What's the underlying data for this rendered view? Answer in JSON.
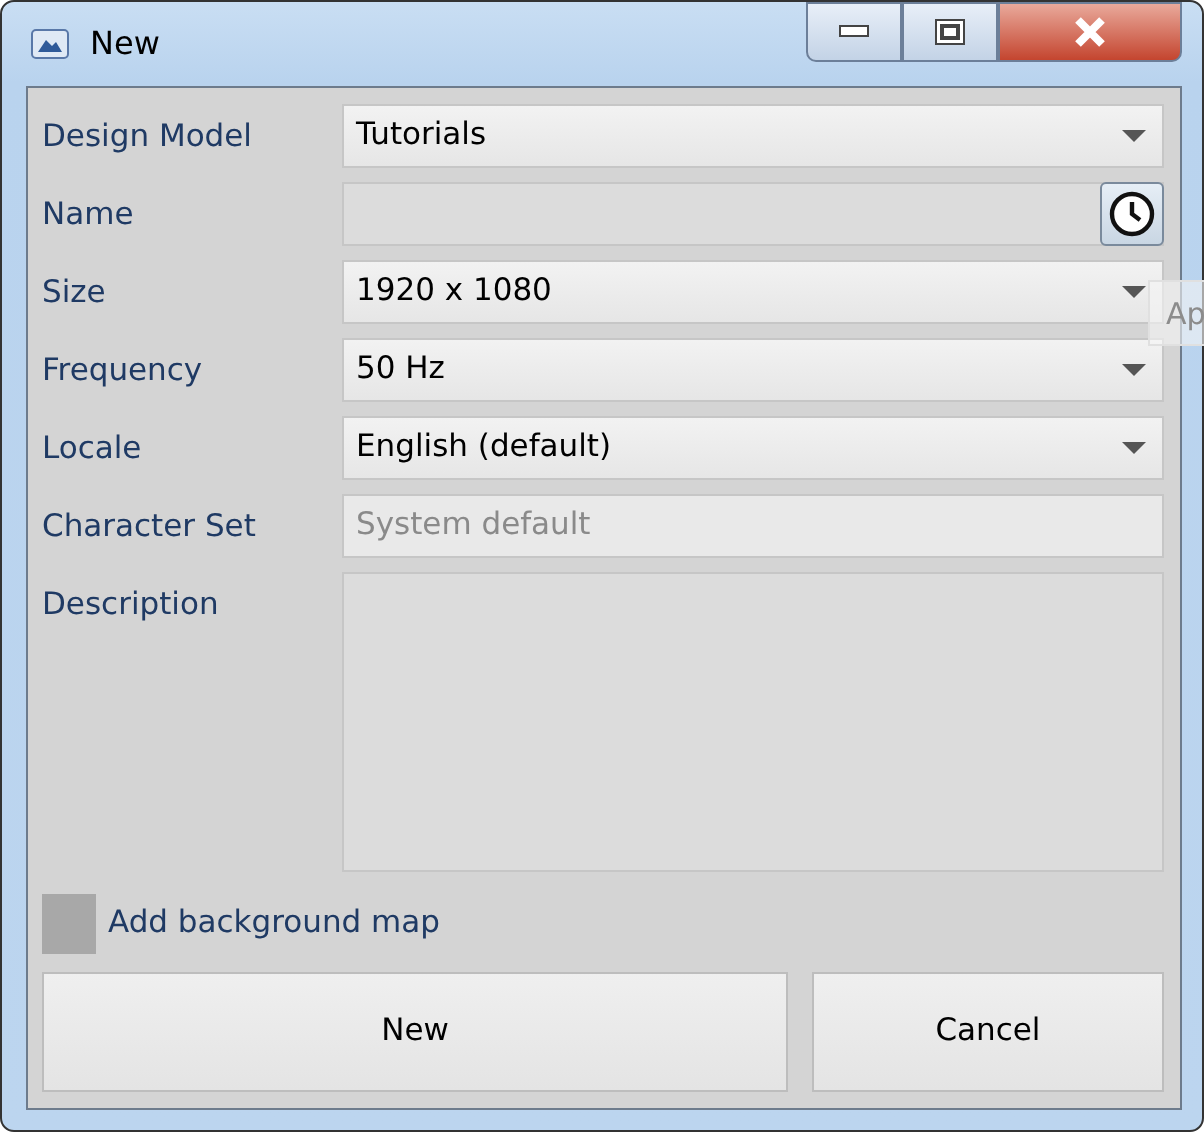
{
  "window": {
    "title": "New"
  },
  "fields": [
    {
      "label": "Design Model",
      "kind": "dropdown",
      "value": "Tutorials"
    },
    {
      "label": "Name",
      "kind": "history"
    },
    {
      "label": "Size",
      "kind": "dropdown",
      "value": "1920 x 1080"
    },
    {
      "label": "Frequency",
      "kind": "dropdown",
      "value": "50 Hz"
    },
    {
      "label": "Locale",
      "kind": "dropdown",
      "value": "English (default)"
    },
    {
      "label": "Character Set",
      "kind": "text",
      "placeholder": "System default"
    },
    {
      "label": "Description",
      "kind": "textarea"
    }
  ],
  "tooltip": "Ap",
  "background_map": {
    "label": "Add background map",
    "checked": false
  },
  "buttons": [
    "New",
    "Cancel"
  ]
}
